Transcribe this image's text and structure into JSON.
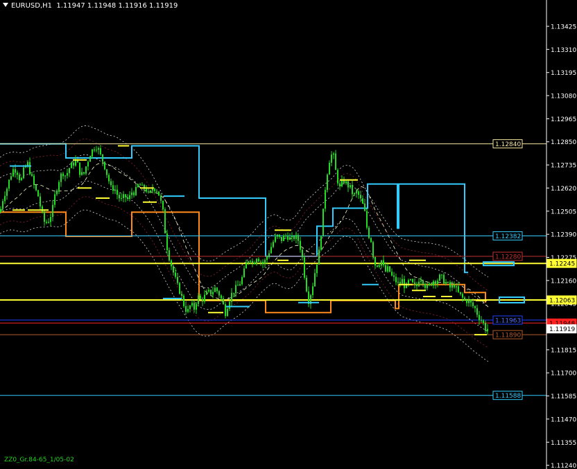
{
  "header": {
    "symbol": "EURUSD,H1",
    "open": "1.11947",
    "high": "1.11948",
    "low": "1.11916",
    "close": "1.11919"
  },
  "footer_label": "ZZ0_Gr.84-65_1/05-02",
  "colors": {
    "background": "#000000",
    "candle": "#22dd22",
    "axis": "#ffffff",
    "level_yellow": "#ffff33",
    "level_cyan": "#33ccff",
    "level_orange": "#ff8c1a",
    "level_blue": "#1f3fff",
    "level_red": "#ff2020",
    "level_brown": "#b05a2a"
  },
  "chart_data": {
    "type": "candlestick",
    "price_axis": {
      "ticks": [
        "1.13425",
        "1.13310",
        "1.13195",
        "1.13080",
        "1.12965",
        "1.12850",
        "1.12735",
        "1.12620",
        "1.12505",
        "1.12390",
        "1.12275",
        "1.12160",
        "1.12045",
        "1.11930",
        "1.11815",
        "1.11700",
        "1.11585",
        "1.11470",
        "1.11355",
        "1.11240"
      ],
      "range": [
        1.1124,
        1.1348
      ]
    },
    "price_labels": [
      {
        "value": "1.12840",
        "price": 1.1284,
        "style": "outline-yellow"
      },
      {
        "value": "1.12382",
        "price": 1.12382,
        "style": "outline-cyan"
      },
      {
        "value": "1.12280",
        "price": 1.1228,
        "style": "outline-red"
      },
      {
        "value": "1.12245",
        "price": 1.12245,
        "style": "fill-yellow"
      },
      {
        "value": "1.12063",
        "price": 1.12063,
        "style": "fill-yellow"
      },
      {
        "value": "1.11963",
        "price": 1.11963,
        "style": "outline-blue"
      },
      {
        "value": "1.11948",
        "price": 1.11948,
        "style": "fill-red"
      },
      {
        "value": "1.11919",
        "price": 1.11919,
        "style": "fill-white"
      },
      {
        "value": "1.11890",
        "price": 1.1189,
        "style": "outline-brown"
      },
      {
        "value": "1.11588",
        "price": 1.11588,
        "style": "outline-cyan"
      }
    ],
    "horizontal_levels": [
      {
        "price": 1.1284,
        "color": "#f5e6a0",
        "width": 1
      },
      {
        "price": 1.12382,
        "color": "#33ccff",
        "width": 1
      },
      {
        "price": 1.1228,
        "color": "#c03030",
        "width": 1
      },
      {
        "price": 1.12245,
        "color": "#ffff33",
        "width": 2
      },
      {
        "price": 1.12063,
        "color": "#ffff33",
        "width": 2
      },
      {
        "price": 1.11963,
        "color": "#1f3fff",
        "width": 1
      },
      {
        "price": 1.11948,
        "color": "#ff2020",
        "width": 1
      },
      {
        "price": 1.1189,
        "color": "#b05a2a",
        "width": 1
      },
      {
        "price": 1.11588,
        "color": "#33ccff",
        "width": 1
      }
    ],
    "price_path": [
      [
        0,
        1.125
      ],
      [
        5,
        1.1258
      ],
      [
        10,
        1.1262
      ],
      [
        15,
        1.1268
      ],
      [
        20,
        1.1272
      ],
      [
        25,
        1.127
      ],
      [
        30,
        1.1265
      ],
      [
        35,
        1.1272
      ],
      [
        40,
        1.1274
      ],
      [
        45,
        1.1268
      ],
      [
        50,
        1.1262
      ],
      [
        55,
        1.1258
      ],
      [
        60,
        1.125
      ],
      [
        65,
        1.1244
      ],
      [
        70,
        1.1246
      ],
      [
        75,
        1.125
      ],
      [
        80,
        1.126
      ],
      [
        85,
        1.1266
      ],
      [
        90,
        1.127
      ],
      [
        95,
        1.1268
      ],
      [
        100,
        1.1272
      ],
      [
        105,
        1.1274
      ],
      [
        110,
        1.1276
      ],
      [
        115,
        1.127
      ],
      [
        120,
        1.1268
      ],
      [
        125,
        1.1274
      ],
      [
        130,
        1.1279
      ],
      [
        135,
        1.1282
      ],
      [
        140,
        1.1283
      ],
      [
        145,
        1.1278
      ],
      [
        150,
        1.1274
      ],
      [
        155,
        1.1268
      ],
      [
        160,
        1.1262
      ],
      [
        165,
        1.1262
      ],
      [
        170,
        1.1258
      ],
      [
        175,
        1.1256
      ],
      [
        180,
        1.1258
      ],
      [
        185,
        1.1256
      ],
      [
        190,
        1.126
      ],
      [
        195,
        1.126
      ],
      [
        200,
        1.1264
      ],
      [
        205,
        1.1262
      ],
      [
        210,
        1.1262
      ],
      [
        215,
        1.1258
      ],
      [
        220,
        1.1262
      ],
      [
        225,
        1.1262
      ],
      [
        230,
        1.1258
      ],
      [
        235,
        1.125
      ],
      [
        240,
        1.1234
      ],
      [
        245,
        1.1226
      ],
      [
        250,
        1.122
      ],
      [
        255,
        1.1214
      ],
      [
        260,
        1.121
      ],
      [
        265,
        1.1204
      ],
      [
        270,
        1.12
      ],
      [
        275,
        1.1204
      ],
      [
        280,
        1.1202
      ],
      [
        285,
        1.1208
      ],
      [
        290,
        1.1206
      ],
      [
        295,
        1.1208
      ],
      [
        300,
        1.121
      ],
      [
        305,
        1.121
      ],
      [
        310,
        1.1212
      ],
      [
        315,
        1.121
      ],
      [
        320,
        1.1206
      ],
      [
        325,
        1.12
      ],
      [
        330,
        1.1206
      ],
      [
        335,
        1.121
      ],
      [
        340,
        1.1212
      ],
      [
        345,
        1.1214
      ],
      [
        350,
        1.1218
      ],
      [
        355,
        1.1224
      ],
      [
        360,
        1.1228
      ],
      [
        365,
        1.1224
      ],
      [
        370,
        1.1228
      ],
      [
        375,
        1.1226
      ],
      [
        380,
        1.1224
      ],
      [
        385,
        1.1228
      ],
      [
        390,
        1.1232
      ],
      [
        395,
        1.1236
      ],
      [
        400,
        1.1238
      ],
      [
        405,
        1.1236
      ],
      [
        410,
        1.1238
      ],
      [
        415,
        1.1238
      ],
      [
        420,
        1.1236
      ],
      [
        425,
        1.1238
      ],
      [
        430,
        1.1236
      ],
      [
        435,
        1.123
      ],
      [
        440,
        1.1216
      ],
      [
        445,
        1.1206
      ],
      [
        450,
        1.1212
      ],
      [
        455,
        1.1222
      ],
      [
        460,
        1.123
      ],
      [
        465,
        1.1246
      ],
      [
        470,
        1.1266
      ],
      [
        475,
        1.1276
      ],
      [
        480,
        1.128
      ],
      [
        485,
        1.1268
      ],
      [
        490,
        1.1262
      ],
      [
        495,
        1.1266
      ],
      [
        500,
        1.1264
      ],
      [
        505,
        1.1262
      ],
      [
        510,
        1.1258
      ],
      [
        515,
        1.126
      ],
      [
        520,
        1.1256
      ],
      [
        525,
        1.1252
      ],
      [
        530,
        1.124
      ],
      [
        535,
        1.1236
      ],
      [
        540,
        1.1224
      ],
      [
        545,
        1.1224
      ],
      [
        550,
        1.1226
      ],
      [
        555,
        1.122
      ],
      [
        560,
        1.1222
      ],
      [
        565,
        1.1218
      ],
      [
        570,
        1.1216
      ],
      [
        575,
        1.1214
      ],
      [
        580,
        1.1216
      ],
      [
        585,
        1.1212
      ],
      [
        590,
        1.1216
      ],
      [
        595,
        1.1214
      ],
      [
        600,
        1.1212
      ],
      [
        605,
        1.1218
      ],
      [
        610,
        1.1216
      ],
      [
        615,
        1.1212
      ],
      [
        620,
        1.1214
      ],
      [
        625,
        1.1216
      ],
      [
        630,
        1.1216
      ],
      [
        635,
        1.1218
      ],
      [
        640,
        1.1216
      ],
      [
        645,
        1.1214
      ],
      [
        650,
        1.1212
      ],
      [
        655,
        1.1214
      ],
      [
        660,
        1.121
      ],
      [
        665,
        1.1208
      ],
      [
        670,
        1.1206
      ],
      [
        675,
        1.1206
      ],
      [
        680,
        1.1204
      ],
      [
        685,
        1.1202
      ],
      [
        690,
        1.1198
      ],
      [
        695,
        1.1196
      ],
      [
        700,
        1.1192
      ],
      [
        703,
        1.1192
      ]
    ]
  }
}
